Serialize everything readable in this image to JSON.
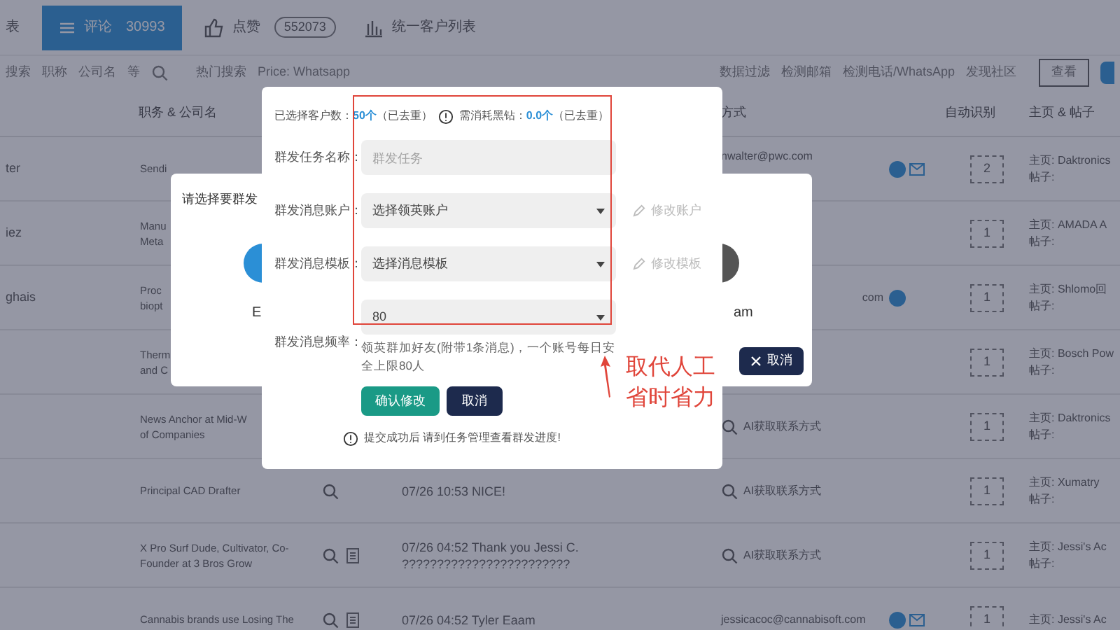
{
  "top_tabs": [
    {
      "label": "表",
      "selected": false,
      "kind": "plain"
    },
    {
      "label": "评论",
      "count": "30993",
      "selected": true,
      "kind": "menu"
    },
    {
      "label": "点赞",
      "count": "552073",
      "selected": false,
      "kind": "like"
    },
    {
      "label": "统一客户列表",
      "selected": false,
      "kind": "list"
    }
  ],
  "filter_bar": {
    "left": [
      "搜索",
      "职称",
      "公司名",
      "等"
    ],
    "hot_label": "热门搜索",
    "hot_value": "Price: Whatsapp",
    "right": [
      "数据过滤",
      "检测邮箱",
      "检测电话/WhatsApp",
      "发现社区"
    ],
    "view_button": "查看"
  },
  "table": {
    "columns": [
      "职务 & 公司名",
      "方式",
      "自动识别",
      "主页 & 帖子"
    ],
    "rows": [
      {
        "name": "ter",
        "job": "Sendi",
        "attached": false,
        "contact": "nwalter@pwc.com",
        "kind": "email",
        "verified": true,
        "mail": true,
        "count": "2",
        "home": "主页: Daktronics",
        "post": "帖子:"
      },
      {
        "name": "iez",
        "job": "Manu\nMeta",
        "attached": false,
        "verified": false,
        "mail": false,
        "count": "1",
        "home": "主页: AMADA A",
        "post": "帖子:"
      },
      {
        "name": "ghais",
        "job": "Proc\nbiopt",
        "attached": false,
        "contact": "com",
        "kind": "tail",
        "verified": true,
        "mail": false,
        "count": "1",
        "home": "主页: Shlomo回",
        "post": "帖子:"
      },
      {
        "job": "Therm\nand C",
        "attached": false,
        "verified": false,
        "mail": false,
        "count": "1",
        "home": "主页: Bosch Pow",
        "post": "帖子:"
      },
      {
        "job": "News Anchor at Mid-W\nof Companies",
        "attached": false,
        "contact": "AI获取联系方式",
        "kind": "ai",
        "verified": false,
        "mail": false,
        "count": "1",
        "home": "主页: Daktronics",
        "post": "帖子:"
      },
      {
        "job": "Principal CAD Drafter",
        "message": "07/26 10:53 NICE!",
        "attached": false,
        "contact": "AI获取联系方式",
        "kind": "ai",
        "verified": false,
        "mail": false,
        "count": "1",
        "home": "主页: Xumatry",
        "post": "帖子:"
      },
      {
        "job": "X Pro Surf Dude, Cultivator, Co-\nFounder at 3 Bros Grow",
        "message": "07/26 04:52 Thank you Jessi C.\n????????????????????????",
        "attached": true,
        "contact": "AI获取联系方式",
        "kind": "ai",
        "verified": false,
        "mail": false,
        "count": "1",
        "home": "主页: Jessi's Ac",
        "post": "帖子:"
      },
      {
        "job": "Cannabis brands use Losing The",
        "message": "07/26 04:52 Tyler Eaam",
        "attached": true,
        "contact": "jessicacoc@cannabisoft.com",
        "kind": "email",
        "verified": true,
        "mail": true,
        "count": "1",
        "home": "主页: Jessi's Ac"
      }
    ]
  },
  "back_dialog": {
    "title": "请选择要群发",
    "left_label": "E",
    "right_label": "am",
    "cancel": "取消"
  },
  "modal": {
    "selected_label": "已选择客户数：",
    "selected_value": "50个",
    "selected_note": "（已去重）",
    "cost_label": "需消耗黑钻：",
    "cost_value": "0.0个",
    "cost_note": "（已去重）",
    "fields": [
      {
        "label": "群发任务名称：",
        "kind": "input",
        "placeholder": "群发任务"
      },
      {
        "label": "群发消息账户：",
        "kind": "select",
        "value": "选择领英账户",
        "link": "修改账户"
      },
      {
        "label": "群发消息模板：",
        "kind": "select",
        "value": "选择消息模板",
        "link": "修改模板"
      },
      {
        "label": "群发消息频率：",
        "kind": "select",
        "value": "80"
      }
    ],
    "hint": "领英群加好友(附带1条消息)，一个账号每日安全上限80人",
    "confirm": "确认修改",
    "cancel": "取消",
    "note": "提交成功后 请到任务管理查看群发进度!"
  },
  "annotation": {
    "lines": [
      "取代人工",
      "省时省力"
    ]
  }
}
